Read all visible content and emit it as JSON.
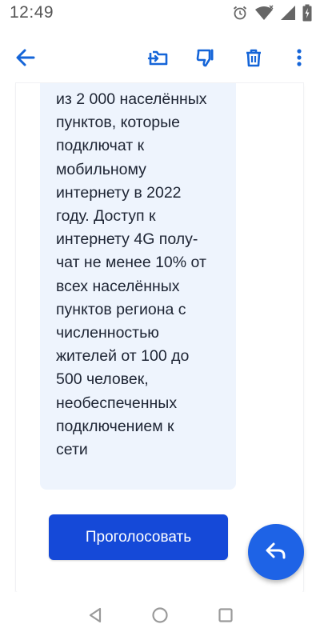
{
  "status_bar": {
    "time": "12:49"
  },
  "icons": {
    "alarm": "alarm-icon",
    "wifi": "wifi-icon",
    "signal": "signal-icon",
    "battery": "battery-charging-icon",
    "back": "arrow-left-icon",
    "move": "move-to-folder-icon",
    "spam": "thumbs-down-icon",
    "delete": "trash-icon",
    "more": "more-vertical-icon",
    "reply": "reply-icon"
  },
  "message": {
    "body_lines": "из 2 000 населённых\nпунктов, которые\nподключат к\nмобильному\nинтернету в 2022\nгоду. Доступ к\nинтернету 4G полу-\nчат не менее 10% от\nвсех населённых\nпунктов региона с\nчисленностью\nжителей от 100 до\n500 человек,\nнеобеспеченных\nподключением к\nсети"
  },
  "actions": {
    "vote_label": "Проголосовать"
  },
  "colors": {
    "accent": "#1e63e6",
    "button": "#1549d8",
    "bubble": "#eef4fd",
    "toolbar_icons": "#1565d8"
  }
}
